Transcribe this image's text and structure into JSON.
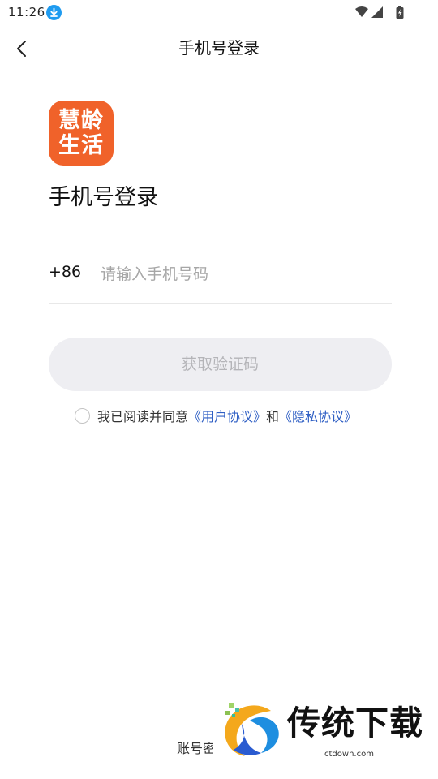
{
  "status_bar": {
    "time": "11:26",
    "icons": [
      "download-icon",
      "wifi-icon",
      "signal-icon",
      "battery-icon"
    ]
  },
  "header": {
    "back_icon": "chevron-left-icon",
    "title": "手机号登录"
  },
  "logo": {
    "line1": "慧龄",
    "line2": "生活",
    "color": "#f0622a"
  },
  "page_title": "手机号登录",
  "phone": {
    "country_code": "+86",
    "value": "",
    "placeholder": "请输入手机号码"
  },
  "get_code_button": "获取验证码",
  "agreement": {
    "prefix": "我已阅读并同意",
    "user_agreement": "《用户协议》",
    "conjunction": "和",
    "privacy_agreement": "《隐私协议》"
  },
  "bottom_text": "账号密",
  "watermark": {
    "title": "传统下载",
    "subtitle": "ctdown.com"
  },
  "colors": {
    "link": "#2f5fc4",
    "button_bg": "#eeeef2",
    "button_text": "#b4b4b8",
    "download_badge": "#1e9bf0"
  }
}
